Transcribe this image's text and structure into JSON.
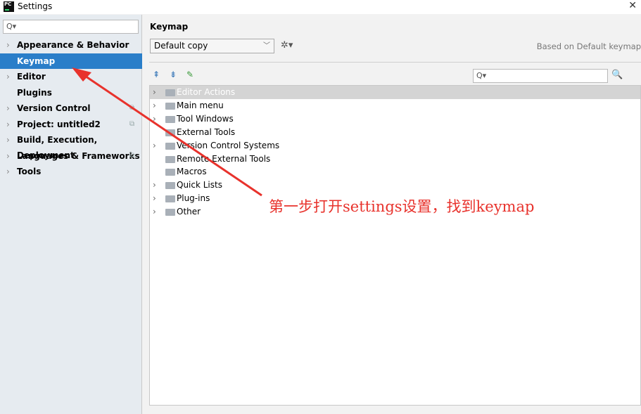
{
  "window": {
    "title": "Settings",
    "app_icon_text": "PC",
    "close": "✕"
  },
  "sidebar": {
    "search_placeholder": "Q▾",
    "items": [
      {
        "label": "Appearance & Behavior",
        "expandable": true
      },
      {
        "label": "Keymap",
        "expandable": false,
        "selected": true
      },
      {
        "label": "Editor",
        "expandable": true
      },
      {
        "label": "Plugins",
        "expandable": false
      },
      {
        "label": "Version Control",
        "expandable": true,
        "project_icon": true
      },
      {
        "label": "Project: untitled2",
        "expandable": true,
        "project_icon": true
      },
      {
        "label": "Build, Execution, Deployment",
        "expandable": true
      },
      {
        "label": "Languages & Frameworks",
        "expandable": true,
        "project_icon": true
      },
      {
        "label": "Tools",
        "expandable": true
      }
    ]
  },
  "main": {
    "title": "Keymap",
    "keymap_select": "Default copy",
    "based_on": "Based on Default keymap",
    "tree_search_placeholder": "Q▾",
    "tree": [
      {
        "label": "Editor Actions",
        "expandable": true,
        "selected": true
      },
      {
        "label": "Main menu",
        "expandable": true
      },
      {
        "label": "Tool Windows",
        "expandable": true
      },
      {
        "label": "External Tools",
        "expandable": false
      },
      {
        "label": "Version Control Systems",
        "expandable": true
      },
      {
        "label": "Remote External Tools",
        "expandable": false
      },
      {
        "label": "Macros",
        "expandable": false
      },
      {
        "label": "Quick Lists",
        "expandable": true
      },
      {
        "label": "Plug-ins",
        "expandable": true
      },
      {
        "label": "Other",
        "expandable": true
      }
    ]
  },
  "annotation": {
    "text": "第一步打开settings设置，找到keymap",
    "color": "#e8322c"
  },
  "colors": {
    "selection": "#2a7ec9",
    "sidebar_bg": "#e6ebf0"
  }
}
